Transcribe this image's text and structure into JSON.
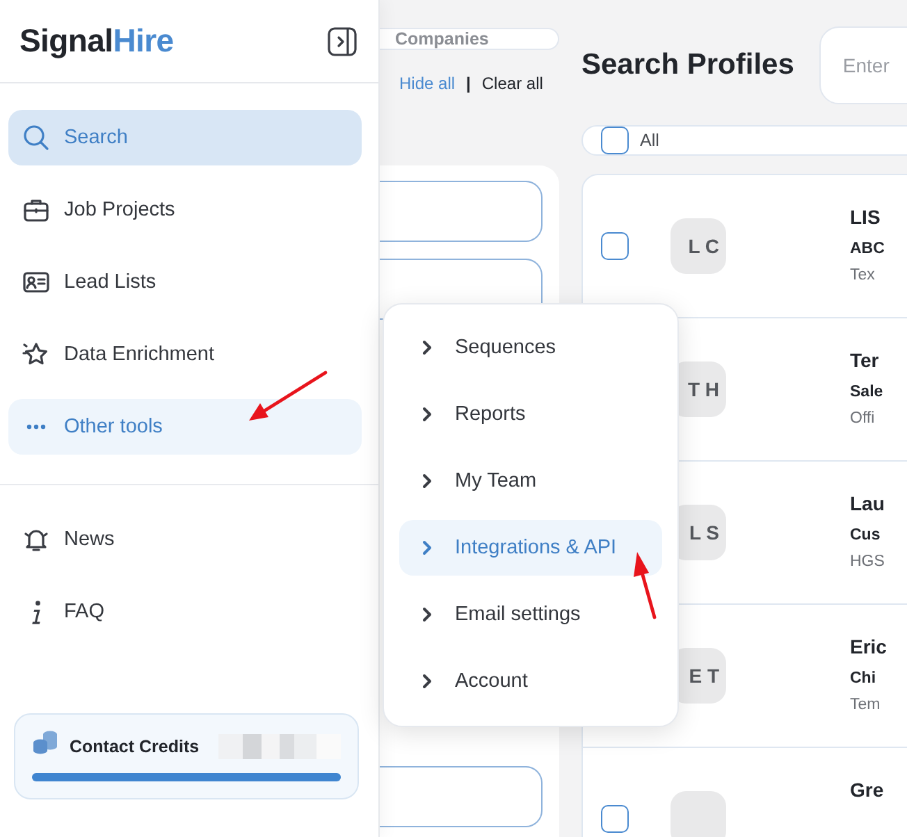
{
  "logo": {
    "part_1": "Signal",
    "part_2": "Hire"
  },
  "sidebar": {
    "items": [
      {
        "kind": "search",
        "label": "Search",
        "selected": true,
        "expanded": false
      },
      {
        "kind": "briefcase",
        "label": "Job Projects",
        "selected": false,
        "expanded": false
      },
      {
        "kind": "card",
        "label": "Lead Lists",
        "selected": false,
        "expanded": false
      },
      {
        "kind": "star",
        "label": "Data Enrichment",
        "selected": false,
        "expanded": false
      },
      {
        "kind": "dots",
        "label": "Other tools",
        "selected": false,
        "expanded": true
      }
    ],
    "secondary_items": [
      {
        "kind": "bell",
        "label": "News"
      },
      {
        "kind": "info",
        "label": "FAQ"
      }
    ],
    "credits": {
      "label": "Contact Credits",
      "level": 1
    }
  },
  "filters": {
    "tab": "Companies",
    "hide_all": "Hide all",
    "separator": "|",
    "clear_all": "Clear all"
  },
  "results": {
    "title": "Search Profiles",
    "search": {
      "placeholder": "Enter"
    },
    "select_all": {
      "label": "All",
      "checked": false
    },
    "rows": [
      {
        "checked": false,
        "initials": "L C",
        "name": "LIS",
        "role": "ABC",
        "company": "Tex"
      },
      {
        "initials": "T H",
        "name": "Ter",
        "role": "Sale",
        "company": "Offi"
      },
      {
        "initials": "L S",
        "name": "Lau",
        "role": "Cus",
        "company": "HGS"
      },
      {
        "initials": "E T",
        "name": "Eric",
        "role": "Chi",
        "company": "Tem"
      },
      {
        "checked": false,
        "name": "Gre"
      }
    ]
  },
  "menu": {
    "items": [
      {
        "label": "Sequences",
        "selected": false
      },
      {
        "label": "Reports",
        "selected": false
      },
      {
        "label": "My Team",
        "selected": false
      },
      {
        "label": "Integrations & API",
        "selected": true
      },
      {
        "label": "Email settings",
        "selected": false
      },
      {
        "label": "Account",
        "selected": false
      }
    ]
  }
}
